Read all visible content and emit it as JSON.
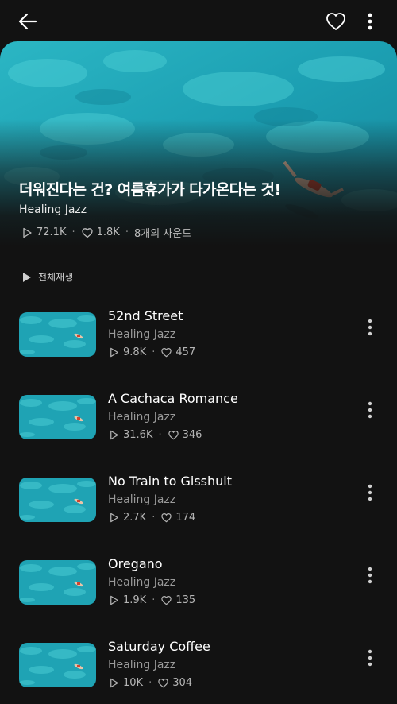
{
  "header": {
    "back_icon": "arrow-left-icon",
    "like_icon": "heart-outline-icon",
    "more_icon": "vertical-dots-icon"
  },
  "playlist": {
    "title": "더워진다는 건? 여름휴가가 다가온다는 것!",
    "artist": "Healing Jazz",
    "plays": "72.1K",
    "likes": "1.8K",
    "sound_count": "8개의 사운드"
  },
  "play_all": {
    "label": "전체재생"
  },
  "tracks": [
    {
      "title": "52nd Street",
      "artist": "Healing Jazz",
      "plays": "9.8K",
      "likes": "457"
    },
    {
      "title": "A Cachaca Romance",
      "artist": "Healing Jazz",
      "plays": "31.6K",
      "likes": "346"
    },
    {
      "title": "No Train to Gisshult",
      "artist": "Healing Jazz",
      "plays": "2.7K",
      "likes": "174"
    },
    {
      "title": "Oregano",
      "artist": "Healing Jazz",
      "plays": "1.9K",
      "likes": "135"
    },
    {
      "title": "Saturday Coffee",
      "artist": "Healing Jazz",
      "plays": "10K",
      "likes": "304"
    }
  ],
  "colors": {
    "background": "#121212",
    "water": "#1fa7b8",
    "meta_text": "#b5b5b5"
  }
}
